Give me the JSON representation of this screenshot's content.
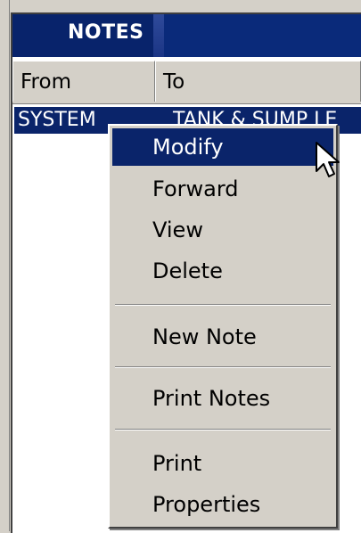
{
  "window": {
    "title": "NOTES"
  },
  "table": {
    "columns": [
      "From",
      "To"
    ],
    "rows": [
      {
        "from": "SYSTEM",
        "to": "TANK & SUMP LE"
      }
    ]
  },
  "context_menu": {
    "items": [
      {
        "label": "Modify"
      },
      {
        "label": "Forward"
      },
      {
        "label": "View"
      },
      {
        "label": "Delete"
      },
      {
        "label": "New Note"
      },
      {
        "label": "Print Notes"
      },
      {
        "label": "Print"
      },
      {
        "label": "Properties"
      }
    ]
  },
  "colors": {
    "title_bar": "#0a2a7a",
    "selection": "#0a246a",
    "menu_bg": "#d4d0c8"
  },
  "icons": {
    "cursor": "arrow-pointer-icon"
  }
}
